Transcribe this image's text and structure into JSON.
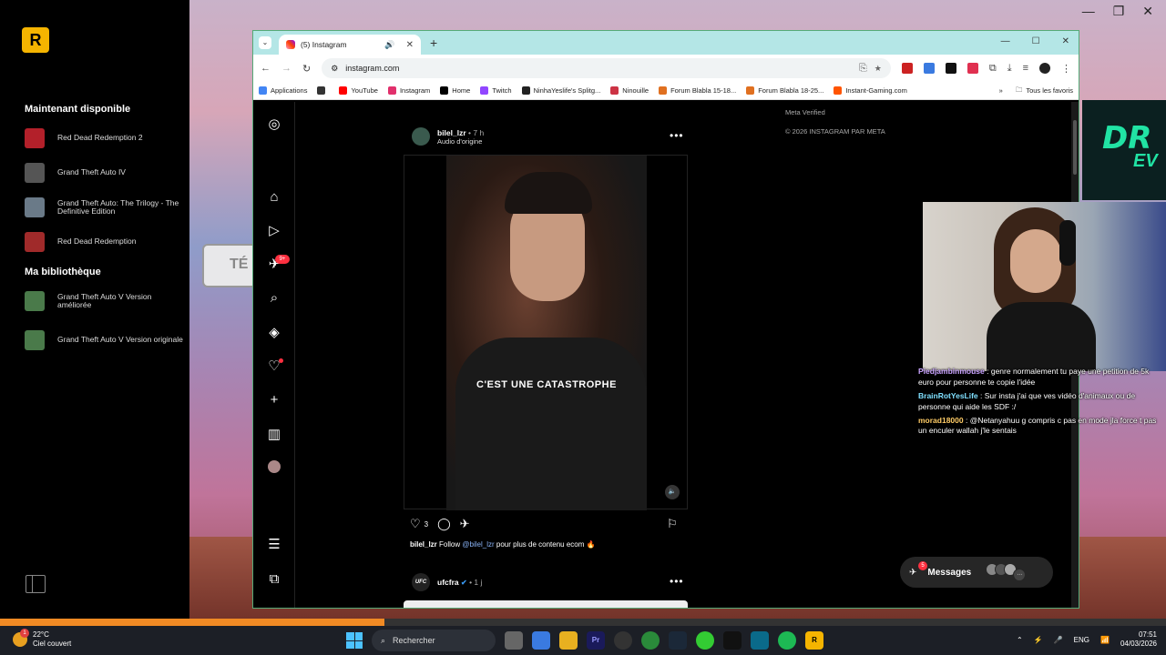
{
  "launcher": {
    "available_heading": "Maintenant disponible",
    "available_games": [
      {
        "name": "Red Dead Redemption 2",
        "color": "#b3202a"
      },
      {
        "name": "Grand Theft Auto IV",
        "color": "#555555"
      },
      {
        "name": "Grand Theft Auto: The Trilogy - The Definitive Edition",
        "color": "#6a7a88"
      },
      {
        "name": "Red Dead Redemption",
        "color": "#a02a2a"
      }
    ],
    "library_heading": "Ma bibliothèque",
    "library_games": [
      {
        "name": "Grand Theft Auto V Version améliorée",
        "color": "#4a7a4a"
      },
      {
        "name": "Grand Theft Auto V Version originale",
        "color": "#4a7a4a"
      }
    ]
  },
  "browser": {
    "tab_title": "(5) Instagram",
    "url": "instagram.com",
    "bookmarks": [
      {
        "label": "Applications",
        "color": "#4285f4"
      },
      {
        "label": "",
        "color": "#333333"
      },
      {
        "label": "YouTube",
        "color": "#ff0000"
      },
      {
        "label": "Instagram",
        "color": "#e1306c"
      },
      {
        "label": "Home",
        "color": "#000000"
      },
      {
        "label": "Twitch",
        "color": "#9146ff"
      },
      {
        "label": "NinhaYeslife's Splitg...",
        "color": "#222222"
      },
      {
        "label": "Ninouille",
        "color": "#cc3344"
      },
      {
        "label": "Forum Blabla 15-18...",
        "color": "#e07020"
      },
      {
        "label": "Forum Blabla 18-25...",
        "color": "#e07020"
      },
      {
        "label": "Instant-Gaming.com",
        "color": "#ff5400"
      }
    ],
    "bookmarks_more": "»",
    "all_bookmarks": "Tous les favoris"
  },
  "instagram": {
    "footer_line1": "Meta Verified",
    "footer_line2": "© 2026 INSTAGRAM PAR META",
    "post": {
      "username": "bilel_lzr",
      "time": "7 h",
      "audio": "Audio d'origine",
      "video_caption": "C'EST UNE CATASTROPHE",
      "likes": "3",
      "caption_user": "bilel_lzr",
      "caption_text_1": "Follow",
      "caption_link": "@bilel_lzr",
      "caption_text_2": "pour plus de contenu ecom 🔥"
    },
    "post2": {
      "username": "ufcfra",
      "time": "1 j",
      "logo_text": "UFC"
    },
    "notif_badge": "9+",
    "messages_label": "Messages",
    "messages_badge": "5"
  },
  "stream": {
    "chat": [
      {
        "user": "Piedjambinmouse",
        "text": "genre normalement tu paye une petition de 5k euro pour personne te copie l'idée",
        "cls": "u1"
      },
      {
        "user": "BrainRotYesLife",
        "text": "Sur insta j'ai que ves vidéo d'animaux ou de personne qui aide les SDF :/",
        "cls": "u2"
      },
      {
        "user": "morad18000",
        "text": "@Netanyahuu g compris c pas en mode jla force t pas un enculer wallah j'le sentais",
        "cls": "u3"
      }
    ]
  },
  "taskbar": {
    "temp": "22°C",
    "weather": "Ciel couvert",
    "weather_badge": "1",
    "search": "Rechercher",
    "lang": "ENG",
    "time": "07:51",
    "date": "04/03/2026"
  },
  "progress_fraction": 0.33
}
